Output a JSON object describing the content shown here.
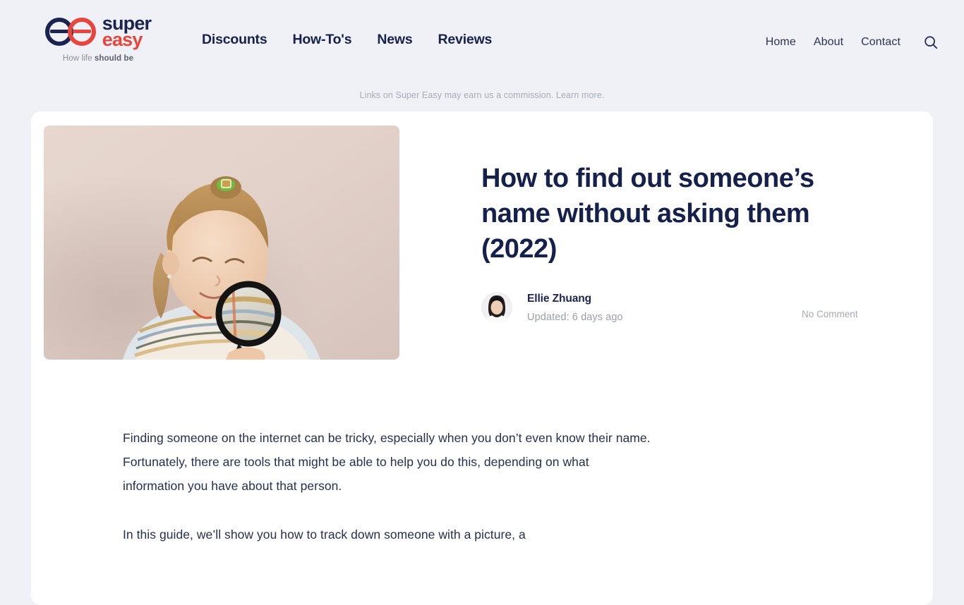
{
  "brand": {
    "logo_icon": "superreasy-double-ring-logo",
    "word_1": "super",
    "word_2": "easy",
    "word_1_color": "#1b2450",
    "word_2_color": "#e8453c",
    "tagline_prefix": "How life ",
    "tagline_bold": "should be"
  },
  "nav": {
    "main": [
      {
        "label": "Discounts"
      },
      {
        "label": "How-To's"
      },
      {
        "label": "News"
      },
      {
        "label": "Reviews"
      }
    ],
    "right": [
      {
        "label": "Home"
      },
      {
        "label": "About"
      },
      {
        "label": "Contact"
      }
    ],
    "search_icon": "search-icon"
  },
  "disclosure": {
    "text": "Links on Super Easy may earn us a commission. Learn more."
  },
  "article": {
    "hero_alt": "girl-with-magnifying-glass",
    "title": "How to find out someone’s name without asking them (2022)",
    "author": {
      "name": "Ellie Zhuang",
      "avatar_alt": "author-portrait"
    },
    "updated": "Updated: 6 days ago",
    "comments": "No Comment",
    "paragraphs": [
      "Finding someone on the internet can be tricky, especially when you don’t even know their name. Fortunately, there are tools that might be able to help you do this, depending on what information you have about that person.",
      "In this guide, we’ll show you how to track down someone with a picture, a"
    ]
  },
  "theme": {
    "page_bg": "#eff1f6",
    "card_bg": "#ffffff",
    "navy": "#16204c",
    "red": "#e8453c",
    "muted": "#a7abb6"
  }
}
